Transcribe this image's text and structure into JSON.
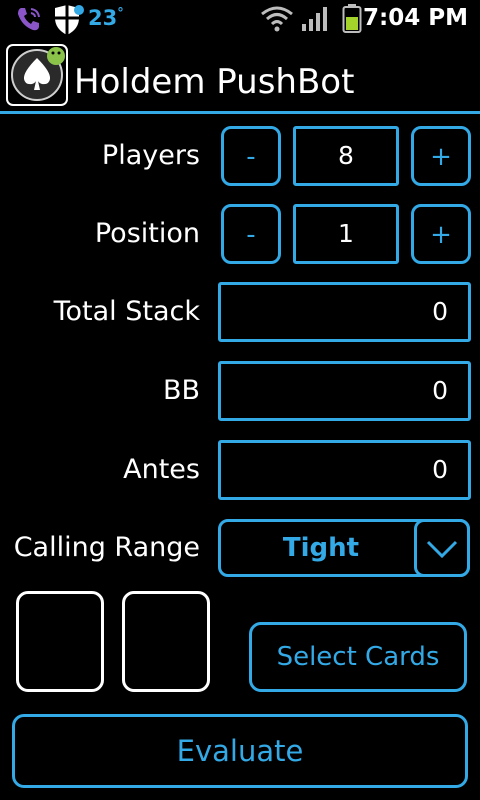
{
  "status_bar": {
    "temperature": "23",
    "temperature_unit": "°",
    "time": "7:04 PM",
    "icons": [
      "phone-icon",
      "shield-icon",
      "wifi-icon",
      "signal-icon",
      "battery-icon"
    ]
  },
  "header": {
    "title": "Holdem PushBot",
    "icon": "spade-app-icon"
  },
  "form": {
    "players": {
      "label": "Players",
      "value": "8",
      "decrement": "-",
      "increment": "+"
    },
    "position": {
      "label": "Position",
      "value": "1",
      "decrement": "-",
      "increment": "+"
    },
    "total_stack": {
      "label": "Total Stack",
      "value": "0"
    },
    "bb": {
      "label": "BB",
      "value": "0"
    },
    "antes": {
      "label": "Antes",
      "value": "0"
    },
    "calling_range": {
      "label": "Calling Range",
      "value": "Tight"
    }
  },
  "buttons": {
    "select_cards": "Select Cards",
    "evaluate": "Evaluate"
  },
  "colors": {
    "accent": "#33a9e6",
    "background": "#000000",
    "text": "#ffffff"
  }
}
